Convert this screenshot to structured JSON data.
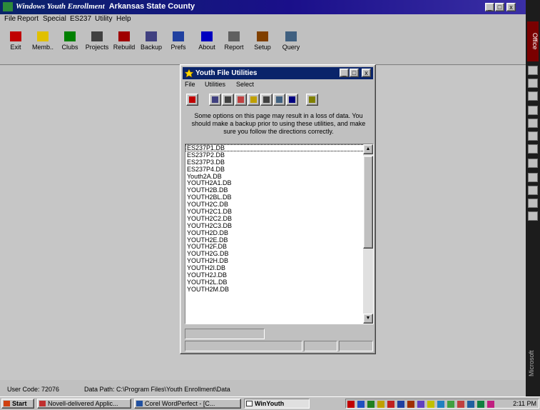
{
  "main_window": {
    "title_app": "Windows Youth Enrollment",
    "title_county": "Arkansas State County",
    "caption_buttons": [
      "_",
      "□",
      "x"
    ],
    "menu": [
      "File",
      "Report",
      "Special",
      "ES237",
      "Utility",
      "Help"
    ],
    "toolbar": [
      {
        "label": "Exit",
        "icon": "exit-door-icon",
        "color": "#c00000"
      },
      {
        "label": "Memb..",
        "icon": "member-person-icon",
        "color": "#e0c000"
      },
      {
        "label": "Clubs",
        "icon": "clubs-clover-icon",
        "color": "#008000"
      },
      {
        "label": "Projects",
        "icon": "projects-monitor-icon",
        "color": "#404040"
      },
      {
        "label": "Rebuild",
        "icon": "rebuild-arrows-icon",
        "color": "#a00000"
      },
      {
        "label": "Backup",
        "icon": "backup-disk-icon",
        "color": "#404080"
      },
      {
        "label": "Prefs",
        "icon": "prefs-diamond-icon",
        "color": "#2040a0"
      },
      {
        "label": "About",
        "icon": "about-question-icon",
        "color": "#0000c0"
      },
      {
        "label": "Report",
        "icon": "report-printer-icon",
        "color": "#606060"
      },
      {
        "label": "Setup",
        "icon": "setup-tools-icon",
        "color": "#804000"
      },
      {
        "label": "Query",
        "icon": "query-table-icon",
        "color": "#406080"
      }
    ]
  },
  "dialog": {
    "title": "Youth File Utilities",
    "caption_buttons": [
      "_",
      "□",
      "x"
    ],
    "menu": [
      "File",
      "Utilities",
      "Select"
    ],
    "tools": [
      {
        "icon": "exit-door-icon",
        "color": "#c00000"
      },
      {
        "icon": "copy-icon",
        "color": "#404080"
      },
      {
        "icon": "delete-trash-icon",
        "color": "#404040"
      },
      {
        "icon": "move-arrow-icon",
        "color": "#c04040"
      },
      {
        "icon": "wand-icon",
        "color": "#c0a000"
      },
      {
        "icon": "check-table-icon",
        "color": "#404040"
      },
      {
        "icon": "swap-arrows-icon",
        "color": "#406080"
      },
      {
        "icon": "abc-spell-icon",
        "color": "#000080"
      },
      {
        "icon": "list-properties-icon",
        "color": "#808000"
      }
    ],
    "notice": "Some options on this page may result in a loss of data. You should make a backup prior to using these utilities, and make sure you follow the directions correctly.",
    "files": [
      "ES237P1.DB",
      "ES237P2.DB",
      "ES237P3.DB",
      "ES237P4.DB",
      "Youth2A.DB",
      "YOUTH2A1.DB",
      "YOUTH2B.DB",
      "YOUTH2BL.DB",
      "YOUTH2C.DB",
      "YOUTH2C1.DB",
      "YOUTH2C2.DB",
      "YOUTH2C3.DB",
      "YOUTH2D.DB",
      "YOUTH2E.DB",
      "YOUTH2F.DB",
      "YOUTH2G.DB",
      "YOUTH2H.DB",
      "YOUTH2I.DB",
      "YOUTH2J.DB",
      "YOUTH2L.DB",
      "YOUTH2M.DB"
    ]
  },
  "status": {
    "user_code": "User Code: 72076",
    "data_path": "Data Path: C:\\Program Files\\Youth Enrollment\\Data"
  },
  "taskbar": {
    "start": "Start",
    "tasks": [
      "Novell-delivered Applic...",
      "Corel WordPerfect - [C...",
      "WinYouth"
    ],
    "clock": "2:11 PM"
  },
  "sidebar": {
    "label_top": "Office",
    "label_bottom": "Microsoft"
  }
}
